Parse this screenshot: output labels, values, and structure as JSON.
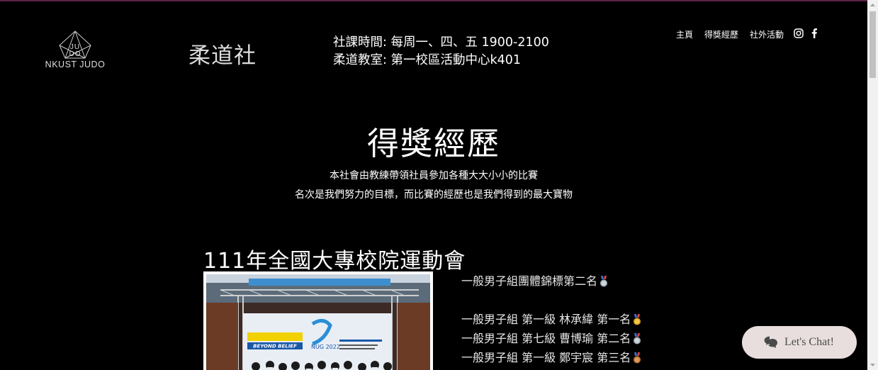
{
  "header": {
    "logo_mark": "JU DO",
    "logo_name": "NKUST JUDO",
    "club_title": "柔道社",
    "schedule_line1": "社課時間: 每周一、四、五 1900-2100",
    "schedule_line2": "柔道教室: 第一校區活動中心k401"
  },
  "nav": {
    "items": [
      "主頁",
      "得獎經歷",
      "社外活動"
    ],
    "social": [
      "instagram-icon",
      "facebook-icon"
    ]
  },
  "main": {
    "page_title": "得獎經歷",
    "intro_line1": "本社會由教練帶領社員參加各種大大小小的比賽",
    "intro_line2": "名次是我們努力的目標，而比賽的經歷也是我們得到的最大寶物",
    "event_title": "111年全國大專校院運動會",
    "results": [
      {
        "text": "一般男子組團體錦標第二名",
        "medal": "silver"
      },
      {
        "text": "一般男子組 第一級 林承緯 第一名",
        "medal": "gold"
      },
      {
        "text": "一般男子組 第七級 曹博瑜 第二名",
        "medal": "silver"
      },
      {
        "text": "一般男子組 第一級 鄭宇宸 第三名",
        "medal": "bronze"
      }
    ],
    "photo_banner": "BEYOND BELIEF",
    "photo_sign": "NUG 2022"
  },
  "chat": {
    "label": "Let's Chat!"
  },
  "colors": {
    "background": "#000000",
    "chat_bg": "#e8dede",
    "gold": "#e0a526",
    "silver": "#a9b3bd",
    "bronze": "#c07a3c"
  }
}
